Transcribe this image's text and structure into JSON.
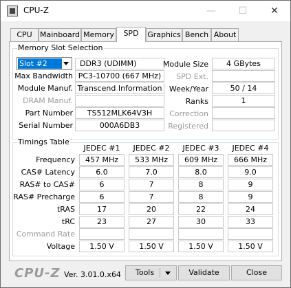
{
  "window": {
    "title": "CPU-Z",
    "minimize_glyph": "—",
    "maximize_glyph": "☐",
    "close_glyph": "✕"
  },
  "tabs": [
    "CPU",
    "Mainboard",
    "Memory",
    "SPD",
    "Graphics",
    "Bench",
    "About"
  ],
  "active_tab": "SPD",
  "slot_selection": {
    "group_title": "Memory Slot Selection",
    "selected_slot": "Slot #2",
    "memory_type": "DDR3 (UDIMM)",
    "labels": {
      "max_bandwidth": "Max Bandwidth",
      "module_manuf": "Module Manuf.",
      "dram_manuf": "DRAM Manuf.",
      "part_number": "Part Number",
      "serial_number": "Serial Number",
      "module_size": "Module Size",
      "spd_ext": "SPD Ext.",
      "week_year": "Week/Year",
      "ranks": "Ranks",
      "correction": "Correction",
      "registered": "Registered"
    },
    "values": {
      "max_bandwidth": "PC3-10700 (667 MHz)",
      "module_manuf": "Transcend Information",
      "dram_manuf": "",
      "part_number": "TS512MLK64V3H",
      "serial_number": "000A6DB3",
      "module_size": "4 GBytes",
      "spd_ext": "",
      "week_year": "50 / 14",
      "ranks": "1",
      "correction": "",
      "registered": ""
    }
  },
  "timings": {
    "group_title": "Timings Table",
    "columns": [
      "JEDEC #1",
      "JEDEC #2",
      "JEDEC #3",
      "JEDEC #4"
    ],
    "rows": [
      {
        "label": "Frequency",
        "values": [
          "457 MHz",
          "533 MHz",
          "609 MHz",
          "666 MHz"
        ]
      },
      {
        "label": "CAS# Latency",
        "values": [
          "6.0",
          "7.0",
          "8.0",
          "9.0"
        ]
      },
      {
        "label": "RAS# to CAS#",
        "values": [
          "6",
          "7",
          "8",
          "9"
        ]
      },
      {
        "label": "RAS# Precharge",
        "values": [
          "6",
          "7",
          "8",
          "9"
        ]
      },
      {
        "label": "tRAS",
        "values": [
          "17",
          "20",
          "22",
          "24"
        ]
      },
      {
        "label": "tRC",
        "values": [
          "23",
          "27",
          "30",
          "33"
        ]
      },
      {
        "label": "Command Rate",
        "values": [
          "",
          "",
          "",
          ""
        ]
      },
      {
        "label": "Voltage",
        "values": [
          "1.50 V",
          "1.50 V",
          "1.50 V",
          "1.50 V"
        ]
      }
    ]
  },
  "footer": {
    "logo": "CPU-Z",
    "version": "Ver. 3.01.0.x64",
    "tools_label": "Tools",
    "validate_label": "Validate",
    "close_label": "Close"
  }
}
